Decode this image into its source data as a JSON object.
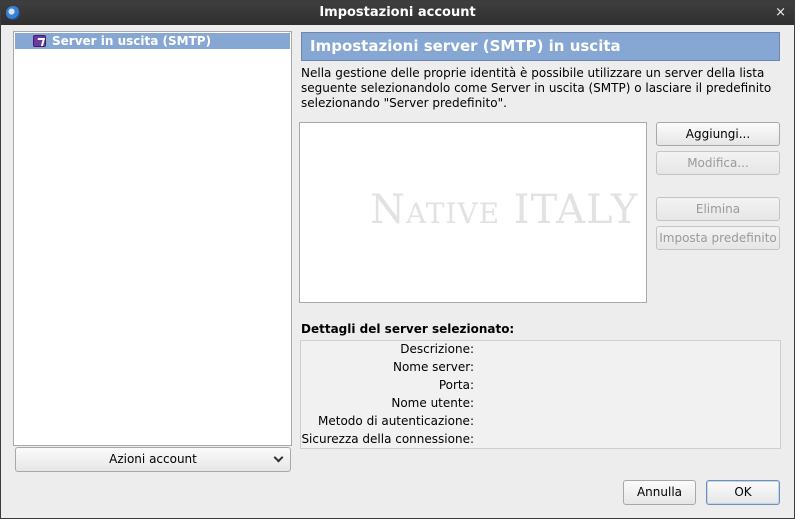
{
  "window": {
    "title": "Impostazioni account",
    "close_glyph": "×",
    "app_icon": "thunderbird-icon"
  },
  "sidebar": {
    "items": [
      {
        "label": "Server in uscita (SMTP)",
        "icon": "outgoing-mail-icon",
        "selected": true
      }
    ],
    "account_actions_label": "Azioni account"
  },
  "main": {
    "header_title": "Impostazioni server (SMTP) in uscita",
    "description": "Nella gestione delle proprie identità è possibile utilizzare un server della lista seguente selezionandolo come Server in uscita (SMTP) o lasciare il predefinito selezionando \"Server predefinito\".",
    "watermark_logo": "NATIVE ITALY",
    "buttons": {
      "add": "Aggiungi...",
      "edit": "Modifica...",
      "delete": "Elimina",
      "set_default": "Imposta predefinito"
    },
    "details_title": "Dettagli del server selezionato:",
    "details_fields": [
      "Descrizione:",
      "Nome server:",
      "Porta:",
      "Nome utente:",
      "Metodo di autenticazione:",
      "Sicurezza della connessione:"
    ]
  },
  "footer": {
    "cancel": "Annulla",
    "ok": "OK"
  },
  "colors": {
    "selection": "#86a6d3",
    "header_bar": "#86a6d3",
    "titlebar": "#333333"
  }
}
